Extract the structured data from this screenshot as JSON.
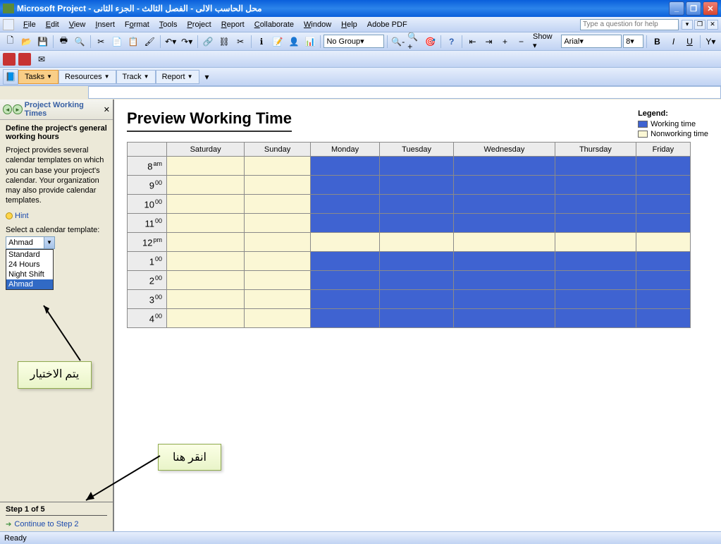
{
  "titlebar": {
    "app": "Microsoft Project",
    "doc": "محل الحاسب الالى - الفصل الثالث - الجزء الثانى"
  },
  "menu": {
    "file": "File",
    "edit": "Edit",
    "view": "View",
    "insert": "Insert",
    "format": "Format",
    "tools": "Tools",
    "project": "Project",
    "report": "Report",
    "collaborate": "Collaborate",
    "window": "Window",
    "help": "Help",
    "adobe": "Adobe PDF",
    "helpbox": "Type a question for help"
  },
  "toolbar2": {
    "nogroup": "No Group",
    "show": "Show",
    "font": "Arial",
    "size": "8"
  },
  "viewbar": {
    "tasks": "Tasks",
    "resources": "Resources",
    "track": "Track",
    "report": "Report"
  },
  "side": {
    "title": "Project Working Times",
    "subtitle": "Define the project's general working hours",
    "desc": "Project provides several calendar templates on which you can base your project's calendar. Your organization may also provide calendar templates.",
    "hint": "Hint",
    "select_label": "Select a calendar template:",
    "selected": "Ahmad",
    "options": {
      "o1": "Standard",
      "o2": "24 Hours",
      "o3": "Night Shift",
      "o4": "Ahmad"
    },
    "step": "Step 1 of 5",
    "continue": "Continue to Step 2"
  },
  "annot": {
    "choose": "يتم الاختيار",
    "click": "انقر هنا"
  },
  "preview": {
    "title": "Preview Working Time",
    "legend": "Legend:",
    "working": "Working time",
    "nonworking": "Nonworking time",
    "days": {
      "sat": "Saturday",
      "sun": "Sunday",
      "mon": "Monday",
      "tue": "Tuesday",
      "wed": "Wednesday",
      "thu": "Thursday",
      "fri": "Friday"
    },
    "hours": [
      {
        "h": "8",
        "s": "am"
      },
      {
        "h": "9",
        "s": "00"
      },
      {
        "h": "10",
        "s": "00"
      },
      {
        "h": "11",
        "s": "00"
      },
      {
        "h": "12",
        "s": "pm"
      },
      {
        "h": "1",
        "s": "00"
      },
      {
        "h": "2",
        "s": "00"
      },
      {
        "h": "3",
        "s": "00"
      },
      {
        "h": "4",
        "s": "00"
      }
    ]
  },
  "chart_data": {
    "type": "table",
    "title": "Preview Working Time",
    "columns": [
      "Saturday",
      "Sunday",
      "Monday",
      "Tuesday",
      "Wednesday",
      "Thursday",
      "Friday"
    ],
    "rows": [
      "8am",
      "9:00",
      "10:00",
      "11:00",
      "12pm",
      "1:00",
      "2:00",
      "3:00",
      "4:00"
    ],
    "legend": {
      "working": "Working time",
      "nonworking": "Nonworking time"
    },
    "values": [
      [
        "nonworking",
        "nonworking",
        "working",
        "working",
        "working",
        "working",
        "working"
      ],
      [
        "nonworking",
        "nonworking",
        "working",
        "working",
        "working",
        "working",
        "working"
      ],
      [
        "nonworking",
        "nonworking",
        "working",
        "working",
        "working",
        "working",
        "working"
      ],
      [
        "nonworking",
        "nonworking",
        "working",
        "working",
        "working",
        "working",
        "working"
      ],
      [
        "nonworking",
        "nonworking",
        "nonworking",
        "nonworking",
        "nonworking",
        "nonworking",
        "nonworking"
      ],
      [
        "nonworking",
        "nonworking",
        "working",
        "working",
        "working",
        "working",
        "working"
      ],
      [
        "nonworking",
        "nonworking",
        "working",
        "working",
        "working",
        "working",
        "working"
      ],
      [
        "nonworking",
        "nonworking",
        "working",
        "working",
        "working",
        "working",
        "working"
      ],
      [
        "nonworking",
        "nonworking",
        "working",
        "working",
        "working",
        "working",
        "working"
      ]
    ]
  },
  "status": "Ready"
}
